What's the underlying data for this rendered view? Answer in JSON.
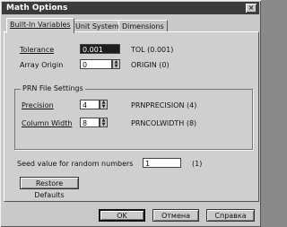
{
  "window": {
    "title": "Math Options",
    "close_glyph": "×"
  },
  "tabs": [
    {
      "label": "Built-In Variables"
    },
    {
      "label": "Unit System"
    },
    {
      "label": "Dimensions"
    }
  ],
  "fields": {
    "tolerance": {
      "label": "Tolerance",
      "value": "0.001",
      "var": "TOL  (0.001)"
    },
    "array_origin": {
      "label": "Array Origin",
      "value": "0",
      "var": "ORIGIN  (0)"
    }
  },
  "prn_group": {
    "title": "PRN File Settings",
    "precision": {
      "label": "Precision",
      "value": "4",
      "var": "PRNPRECISION  (4)"
    },
    "column_width": {
      "label": "Column Width",
      "value": "8",
      "var": "PRNCOLWIDTH  (8)"
    }
  },
  "seed": {
    "label": "Seed value for random numbers",
    "value": "1",
    "var": "(1)"
  },
  "buttons": {
    "restore": "Restore Defaults",
    "ok": "OK",
    "cancel": "Отмена",
    "help": "Справка"
  },
  "spinner_up": "▲",
  "spinner_down": "▼"
}
